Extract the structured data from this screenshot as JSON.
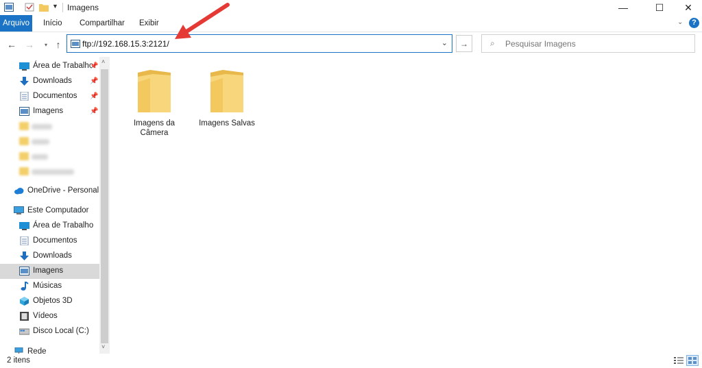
{
  "window": {
    "title": "Imagens",
    "minimize_glyph": "—",
    "maximize_glyph": "☐",
    "close_glyph": "✕"
  },
  "ribbon": {
    "tabs": [
      {
        "label": "Arquivo",
        "active": true
      },
      {
        "label": "Início"
      },
      {
        "label": "Compartilhar"
      },
      {
        "label": "Exibir"
      }
    ],
    "help_glyph": "?"
  },
  "nav": {
    "address": "ftp://192.168.15.3:2121/",
    "search_placeholder": "Pesquisar Imagens"
  },
  "sidebar": {
    "quick_access": [
      {
        "label": "Área de Trabalho",
        "icon": "desktop-icon",
        "pinned": true
      },
      {
        "label": "Downloads",
        "icon": "download-icon",
        "pinned": true
      },
      {
        "label": "Documentos",
        "icon": "document-icon",
        "pinned": true
      },
      {
        "label": "Imagens",
        "icon": "pictures-icon",
        "pinned": true
      }
    ],
    "onedrive": {
      "label": "OneDrive - Personal",
      "icon": "cloud-icon"
    },
    "this_pc": {
      "label": "Este Computador",
      "icon": "computer-icon"
    },
    "pc_items": [
      {
        "label": "Área de Trabalho",
        "icon": "desktop-icon"
      },
      {
        "label": "Documentos",
        "icon": "document-icon"
      },
      {
        "label": "Downloads",
        "icon": "download-icon"
      },
      {
        "label": "Imagens",
        "icon": "pictures-icon",
        "selected": true
      },
      {
        "label": "Músicas",
        "icon": "music-icon"
      },
      {
        "label": "Objetos 3D",
        "icon": "cube-icon"
      },
      {
        "label": "Vídeos",
        "icon": "video-icon"
      },
      {
        "label": "Disco Local (C:)",
        "icon": "drive-icon"
      }
    ],
    "network": {
      "label": "Rede",
      "icon": "network-icon"
    }
  },
  "content": {
    "folders": [
      {
        "label": "Imagens da Câmera"
      },
      {
        "label": "Imagens Salvas"
      }
    ]
  },
  "status": {
    "item_count": "2 itens"
  },
  "colors": {
    "accent": "#1a73c5",
    "selection": "#d9d9d9",
    "annotation_arrow": "#e53935",
    "folder_yellow": "#f5d27a"
  }
}
